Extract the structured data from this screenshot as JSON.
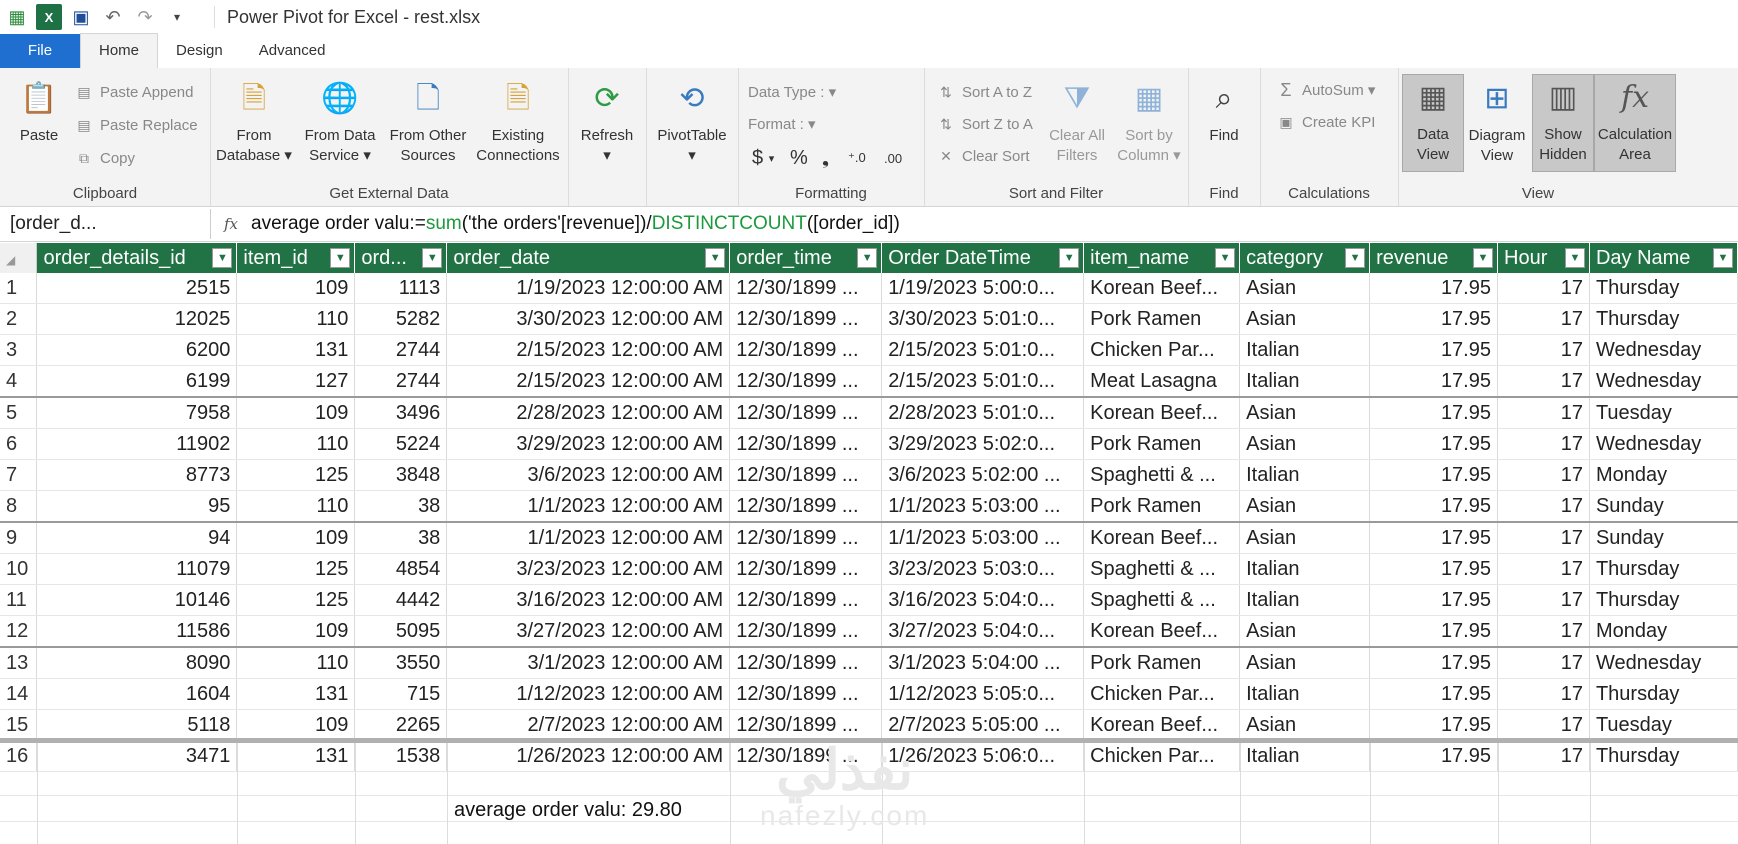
{
  "window": {
    "title": "Power Pivot for Excel - rest.xlsx"
  },
  "tabs": [
    "File",
    "Home",
    "Design",
    "Advanced"
  ],
  "ribbon": {
    "clipboard": {
      "paste": "Paste",
      "paste_append": "Paste Append",
      "paste_replace": "Paste Replace",
      "copy": "Copy",
      "label": "Clipboard"
    },
    "external": {
      "from_database_1": "From",
      "from_database_2": "Database",
      "from_data_service_1": "From Data",
      "from_data_service_2": "Service",
      "from_other_1": "From Other",
      "from_other_2": "Sources",
      "existing_1": "Existing",
      "existing_2": "Connections",
      "label": "Get External Data"
    },
    "refresh": "Refresh",
    "pivottable": "PivotTable",
    "formatting": {
      "data_type": "Data Type :",
      "format": "Format :",
      "dollar": "$",
      "percent": "%",
      "comma": "։",
      "label": "Formatting"
    },
    "sort": {
      "az": "Sort A to Z",
      "za": "Sort Z to A",
      "clear": "Clear Sort",
      "clear_filters_1": "Clear All",
      "clear_filters_2": "Filters",
      "sort_by_col_1": "Sort by",
      "sort_by_col_2": "Column",
      "label": "Sort and Filter"
    },
    "find": {
      "button": "Find",
      "label": "Find"
    },
    "calculations": {
      "autosum": "AutoSum",
      "create_kpi": "Create KPI",
      "label": "Calculations"
    },
    "view": {
      "data_view_1": "Data",
      "data_view_2": "View",
      "diagram_1": "Diagram",
      "diagram_2": "View",
      "show_hidden_1": "Show",
      "show_hidden_2": "Hidden",
      "calc_area_1": "Calculation",
      "calc_area_2": "Area",
      "label": "View"
    }
  },
  "formula_bar": {
    "name_box": "[order_d...",
    "formula_prefix": "average order valu:=",
    "fn1": "sum",
    "arg1": "('the orders'[revenue])/",
    "fn2": "DISTINCTCOUNT",
    "arg2": "([order_id])"
  },
  "table": {
    "columns": [
      "order_details_id",
      "item_id",
      "ord...",
      "order_date",
      "order_time",
      "Order DateTime",
      "item_name",
      "category",
      "revenue",
      "Hour",
      "Day Name"
    ],
    "rows": [
      [
        "1",
        "2515",
        "109",
        "1113",
        "1/19/2023 12:00:00 AM",
        "12/30/1899 ...",
        "1/19/2023 5:00:0...",
        "Korean Beef...",
        "Asian",
        "17.95",
        "17",
        "Thursday"
      ],
      [
        "2",
        "12025",
        "110",
        "5282",
        "3/30/2023 12:00:00 AM",
        "12/30/1899 ...",
        "3/30/2023 5:01:0...",
        "Pork Ramen",
        "Asian",
        "17.95",
        "17",
        "Thursday"
      ],
      [
        "3",
        "6200",
        "131",
        "2744",
        "2/15/2023 12:00:00 AM",
        "12/30/1899 ...",
        "2/15/2023 5:01:0...",
        "Chicken Par...",
        "Italian",
        "17.95",
        "17",
        "Wednesday"
      ],
      [
        "4",
        "6199",
        "127",
        "2744",
        "2/15/2023 12:00:00 AM",
        "12/30/1899 ...",
        "2/15/2023 5:01:0...",
        "Meat Lasagna",
        "Italian",
        "17.95",
        "17",
        "Wednesday"
      ],
      [
        "5",
        "7958",
        "109",
        "3496",
        "2/28/2023 12:00:00 AM",
        "12/30/1899 ...",
        "2/28/2023 5:01:0...",
        "Korean Beef...",
        "Asian",
        "17.95",
        "17",
        "Tuesday"
      ],
      [
        "6",
        "11902",
        "110",
        "5224",
        "3/29/2023 12:00:00 AM",
        "12/30/1899 ...",
        "3/29/2023 5:02:0...",
        "Pork Ramen",
        "Asian",
        "17.95",
        "17",
        "Wednesday"
      ],
      [
        "7",
        "8773",
        "125",
        "3848",
        "3/6/2023 12:00:00 AM",
        "12/30/1899 ...",
        "3/6/2023 5:02:00 ...",
        "Spaghetti & ...",
        "Italian",
        "17.95",
        "17",
        "Monday"
      ],
      [
        "8",
        "95",
        "110",
        "38",
        "1/1/2023 12:00:00 AM",
        "12/30/1899 ...",
        "1/1/2023 5:03:00 ...",
        "Pork Ramen",
        "Asian",
        "17.95",
        "17",
        "Sunday"
      ],
      [
        "9",
        "94",
        "109",
        "38",
        "1/1/2023 12:00:00 AM",
        "12/30/1899 ...",
        "1/1/2023 5:03:00 ...",
        "Korean Beef...",
        "Asian",
        "17.95",
        "17",
        "Sunday"
      ],
      [
        "10",
        "11079",
        "125",
        "4854",
        "3/23/2023 12:00:00 AM",
        "12/30/1899 ...",
        "3/23/2023 5:03:0...",
        "Spaghetti & ...",
        "Italian",
        "17.95",
        "17",
        "Thursday"
      ],
      [
        "11",
        "10146",
        "125",
        "4442",
        "3/16/2023 12:00:00 AM",
        "12/30/1899 ...",
        "3/16/2023 5:04:0...",
        "Spaghetti & ...",
        "Italian",
        "17.95",
        "17",
        "Thursday"
      ],
      [
        "12",
        "11586",
        "109",
        "5095",
        "3/27/2023 12:00:00 AM",
        "12/30/1899 ...",
        "3/27/2023 5:04:0...",
        "Korean Beef...",
        "Asian",
        "17.95",
        "17",
        "Monday"
      ],
      [
        "13",
        "8090",
        "110",
        "3550",
        "3/1/2023 12:00:00 AM",
        "12/30/1899 ...",
        "3/1/2023 5:04:00 ...",
        "Pork Ramen",
        "Asian",
        "17.95",
        "17",
        "Wednesday"
      ],
      [
        "14",
        "1604",
        "131",
        "715",
        "1/12/2023 12:00:00 AM",
        "12/30/1899 ...",
        "1/12/2023 5:05:0...",
        "Chicken Par...",
        "Italian",
        "17.95",
        "17",
        "Thursday"
      ],
      [
        "15",
        "5118",
        "109",
        "2265",
        "2/7/2023 12:00:00 AM",
        "12/30/1899 ...",
        "2/7/2023 5:05:00 ...",
        "Korean Beef...",
        "Asian",
        "17.95",
        "17",
        "Tuesday"
      ],
      [
        "16",
        "3471",
        "131",
        "1538",
        "1/26/2023 12:00:00 AM",
        "12/30/1899 ...",
        "1/26/2023 5:06:0...",
        "Chicken Par...",
        "Italian",
        "17.95",
        "17",
        "Thursday"
      ]
    ]
  },
  "calc_area": {
    "measure": "average order valu: 29.80"
  },
  "watermark": {
    "arabic": "نفذلي",
    "latin": "nafezly.com"
  },
  "colors": {
    "header_green": "#217346",
    "file_tab": "#1f6fd1",
    "function_green": "#1b9a3c"
  }
}
